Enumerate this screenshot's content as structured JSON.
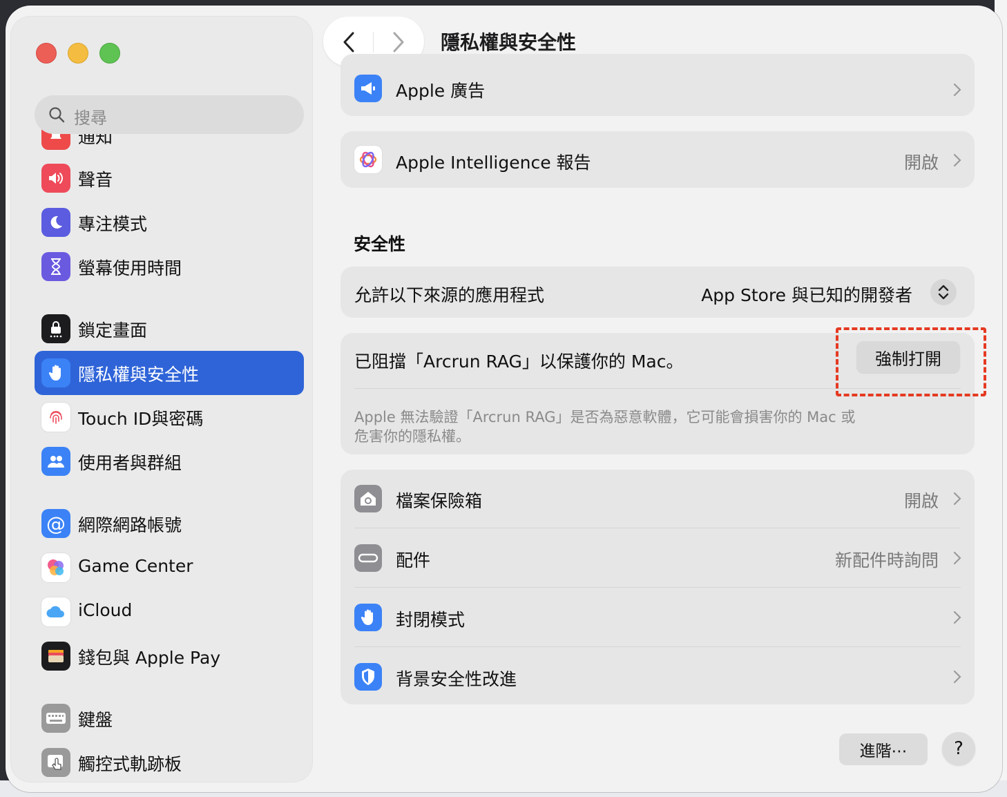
{
  "window": {
    "title": "隱私權與安全性"
  },
  "search": {
    "placeholder": "搜尋"
  },
  "sidebar": {
    "items": [
      {
        "label": "通知",
        "icon": "bell-icon",
        "color": "#ee4a4a"
      },
      {
        "label": "聲音",
        "icon": "speaker-icon",
        "color": "#ee4a5a"
      },
      {
        "label": "專注模式",
        "icon": "moon-icon",
        "color": "#5b5ce0"
      },
      {
        "label": "螢幕使用時間",
        "icon": "hourglass-icon",
        "color": "#6a5ae0"
      },
      {
        "label": "鎖定畫面",
        "icon": "lock-screen-icon",
        "color": "#1c1c1e"
      },
      {
        "label": "隱私權與安全性",
        "icon": "hand-icon",
        "color": "#3b82f6",
        "selected": true
      },
      {
        "label": "Touch ID與密碼",
        "icon": "fingerprint-icon",
        "color": "#ffffff"
      },
      {
        "label": "使用者與群組",
        "icon": "users-icon",
        "color": "#3b82f6"
      },
      {
        "label": "網際網路帳號",
        "icon": "at-icon",
        "color": "#3b82f6"
      },
      {
        "label": "Game Center",
        "icon": "game-center-icon",
        "color": "#ffffff"
      },
      {
        "label": "iCloud",
        "icon": "cloud-icon",
        "color": "#ffffff"
      },
      {
        "label": "錢包與 Apple Pay",
        "icon": "wallet-icon",
        "color": "#1c1c1e"
      },
      {
        "label": "鍵盤",
        "icon": "keyboard-icon",
        "color": "#9a9a9a"
      },
      {
        "label": "觸控式軌跡板",
        "icon": "trackpad-icon",
        "color": "#9a9a9a"
      }
    ]
  },
  "content": {
    "apple_ads": {
      "label": "Apple 廣告"
    },
    "intelligence": {
      "label": "Apple Intelligence 報告",
      "value": "開啟"
    },
    "security_header": "安全性",
    "allow_apps": {
      "label": "允許以下來源的應用程式",
      "value": "App Store 與已知的開發者"
    },
    "blocked": {
      "message": "已阻擋「Arcrun RAG」以保護你的 Mac。",
      "button": "強制打開",
      "desc_line1": "Apple 無法驗證「Arcrun RAG」是否為惡意軟體，它可能會損害你的 Mac 或",
      "desc_line2": "危害你的隱私權。"
    },
    "filevault": {
      "label": "檔案保險箱",
      "value": "開啟"
    },
    "accessories": {
      "label": "配件",
      "value": "新配件時詢問"
    },
    "lockdown": {
      "label": "封閉模式"
    },
    "bg_security": {
      "label": "背景安全性改進"
    }
  },
  "footer": {
    "advanced": "進階⋯",
    "help": "?"
  }
}
